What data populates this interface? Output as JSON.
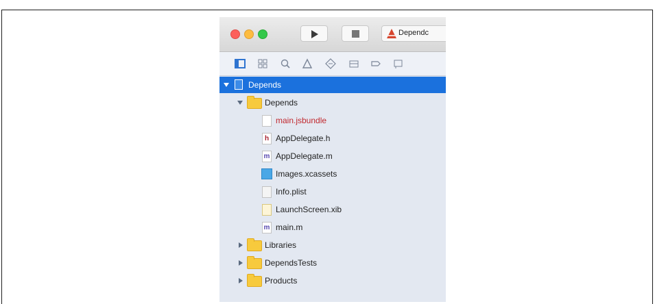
{
  "toolbar": {
    "scheme_label": "Dependc",
    "run_icon": "play-icon",
    "stop_icon": "stop-icon"
  },
  "navigator_icons": [
    "project-navigator-icon",
    "symbol-navigator-icon",
    "find-navigator-icon",
    "issue-navigator-icon",
    "test-navigator-icon",
    "debug-navigator-icon",
    "breakpoint-navigator-icon",
    "report-navigator-icon"
  ],
  "tree": {
    "project": "Depends",
    "group_depends": "Depends",
    "files": {
      "jsbundle": "main.jsbundle",
      "appdelegate_h": "AppDelegate.h",
      "appdelegate_m": "AppDelegate.m",
      "assets": "Images.xcassets",
      "plist": "Info.plist",
      "launch": "LaunchScreen.xib",
      "main": "main.m"
    },
    "group_libraries": "Libraries",
    "group_tests": "DependsTests",
    "group_products": "Products"
  },
  "colors": {
    "selection": "#1b71dd",
    "folder": "#f7ca3d",
    "missing_file": "#c1272d"
  }
}
